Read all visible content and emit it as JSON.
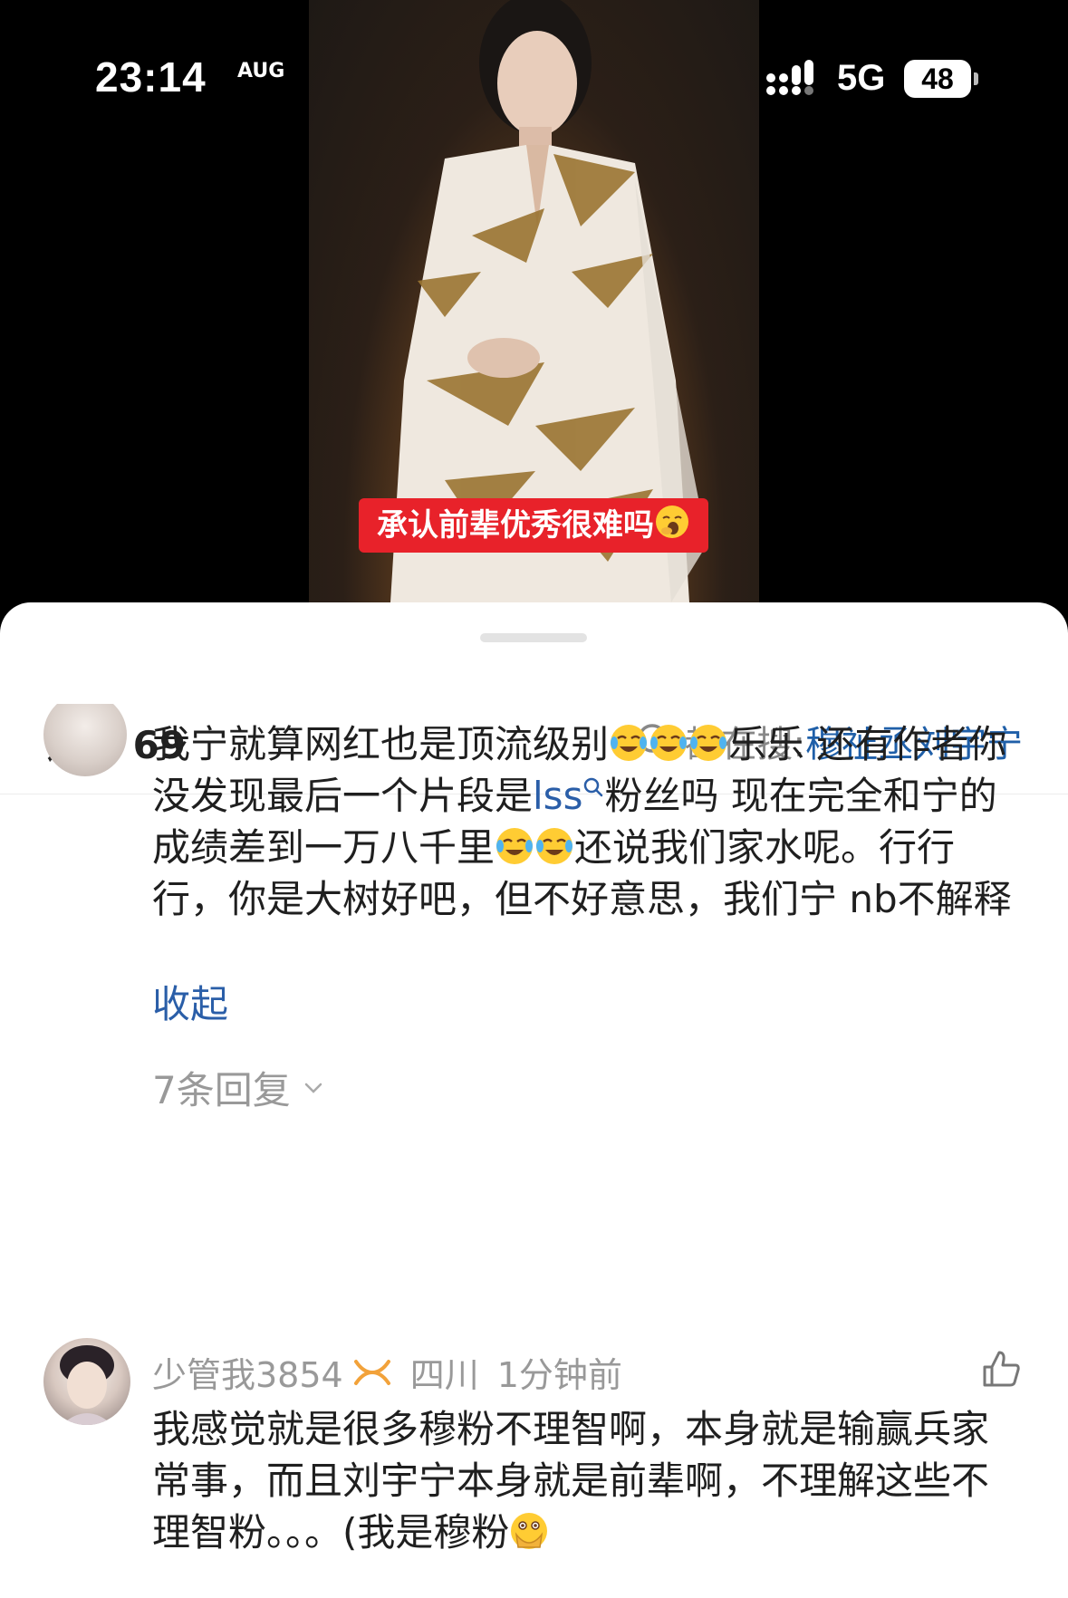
{
  "status_bar": {
    "time": "23:14",
    "time_sub": "AUG",
    "network": "5G",
    "battery": "48"
  },
  "video": {
    "caption": "承认前辈优秀很难吗"
  },
  "comments_header": {
    "title": "评论 69",
    "search_prefix": "都在搜:",
    "search_term": "穆祉丞刘宇宁"
  },
  "comment_1": {
    "text_a": "我宁就算网红也是顶流级别",
    "text_b": "乐乐 还有作者你没发现最后一个片段是",
    "link": "lss",
    "text_c": "粉丝吗 现在完全和宁的成绩差到一万八千里",
    "text_d": "还说我们家水呢。行行行，你是大树好吧，但不好意思，我们宁 nb不解释",
    "collapse_label": "收起",
    "replies_label": "7条回复"
  },
  "comment_2": {
    "username": "少管我3854",
    "location": "四川",
    "time": "1分钟前",
    "text": "我感觉就是很多穆粉不理智啊，本身就是输赢兵家常事，而且刘宇宁本身就是前辈啊，不理解这些不理智粉。。。(我是穆粉"
  },
  "icons": {
    "search": "search-icon",
    "like": "thumbs-up-icon",
    "badge": "fan-badge-icon",
    "chevron": "chevron-down-icon"
  },
  "colors": {
    "link": "#2a5ea8",
    "caption_bg": "#e8222a",
    "muted": "#999999"
  }
}
